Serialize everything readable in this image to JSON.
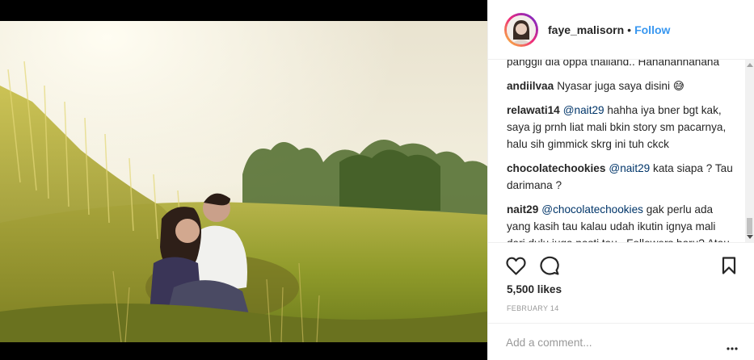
{
  "post": {
    "username": "faye_malisorn",
    "separator": "•",
    "follow_label": "Follow"
  },
  "comments": [
    {
      "user": "",
      "mention": "",
      "text": "panggil dia oppa thailand.. Hahahahhahaha"
    },
    {
      "user": "andiilvaa",
      "mention": "",
      "text": "Nyasar juga saya disini 😅"
    },
    {
      "user": "relawati14",
      "mention": "@nait29",
      "text": "hahha iya bner bgt kak, saya jg prnh liat mali bkin story sm pacarnya, halu sih gimmick skrg ini tuh ckck"
    },
    {
      "user": "chocolatechookies",
      "mention": "@nait29",
      "text": "kata siapa ? Tau darimana ?"
    },
    {
      "user": "nait29",
      "mention": "@chocolatechookies",
      "text": "gak perlu ada yang kasih tau kalau udah ikutin ignya mali dari dulu juga pasti tau.. Followers baru? Atau kesini cuman kepo karena berita igun?"
    }
  ],
  "actions": {
    "like_icon": "heart-icon",
    "comment_icon": "comment-bubble-icon",
    "save_icon": "bookmark-icon"
  },
  "likes_text": "5,500 likes",
  "date_text": "FEBRUARY 14",
  "add_comment": {
    "placeholder": "Add a comment...",
    "more_icon": "more-options-icon"
  },
  "colors": {
    "link_blue": "#3897f0",
    "mention": "#003569",
    "text": "#262626",
    "muted": "#999999"
  }
}
